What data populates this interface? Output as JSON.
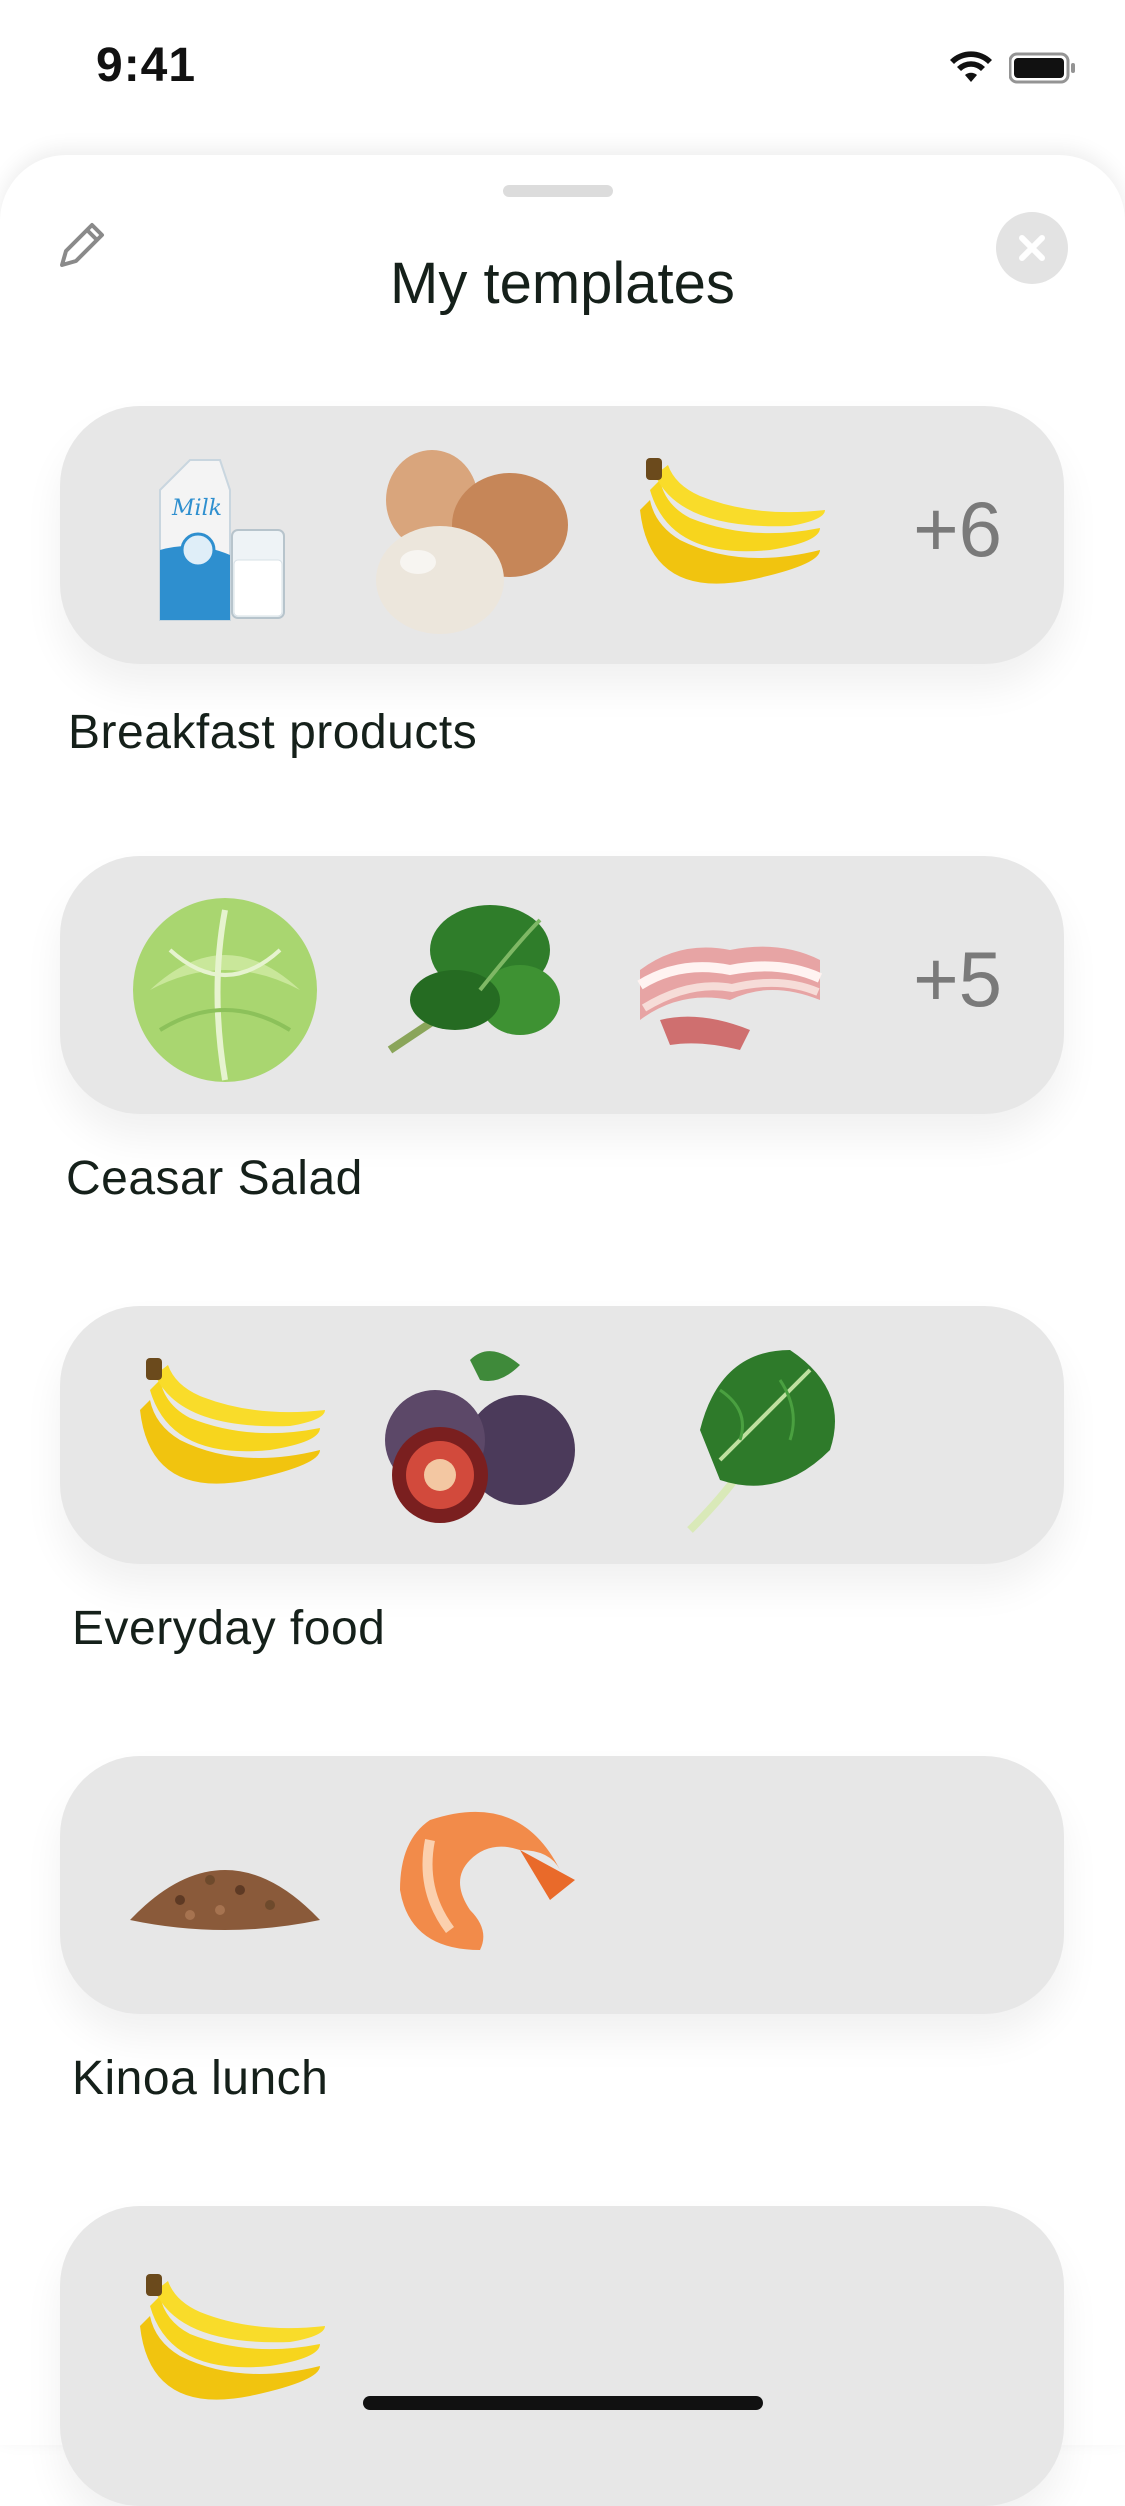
{
  "status_bar": {
    "time": "9:41"
  },
  "sheet": {
    "title": "My templates"
  },
  "templates": [
    {
      "name": "Breakfast products",
      "extra_count": "+6",
      "items": [
        "milk",
        "eggs",
        "bananas"
      ]
    },
    {
      "name": "Ceasar Salad",
      "extra_count": "+5",
      "items": [
        "lettuce",
        "spinach",
        "bacon"
      ]
    },
    {
      "name": "Everyday food",
      "extra_count": "",
      "items": [
        "bananas",
        "figs",
        "leafy-greens"
      ]
    },
    {
      "name": "Kinoa lunch",
      "extra_count": "",
      "items": [
        "buckwheat",
        "shrimp"
      ]
    },
    {
      "name": "",
      "extra_count": "",
      "items": [
        "bananas"
      ]
    }
  ],
  "colors": {
    "card_bg": "#e7e7e7",
    "text": "#15201a",
    "count_text": "#7a7a7a"
  }
}
